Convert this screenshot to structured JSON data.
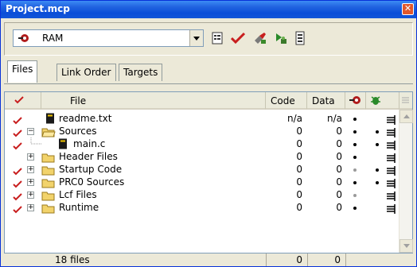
{
  "window": {
    "title": "Project.mcp"
  },
  "toolbar": {
    "target": "RAM",
    "buttons": [
      "settings-icon",
      "check-icon",
      "make-icon",
      "debug-icon",
      "list-icon"
    ]
  },
  "tabs": [
    {
      "label": "Files",
      "active": true
    },
    {
      "label": "Link Order",
      "active": false
    },
    {
      "label": "Targets",
      "active": false
    }
  ],
  "columns": {
    "file": "File",
    "code": "Code",
    "data": "Data"
  },
  "rows": [
    {
      "name": "readme.txt",
      "type": "file",
      "checked": true,
      "expander": "",
      "code": "n/a",
      "data": "n/a",
      "dbg": "black",
      "trg": ""
    },
    {
      "name": "Sources",
      "type": "folder",
      "checked": true,
      "expander": "−",
      "code": "0",
      "data": "0",
      "dbg": "black",
      "trg": "black"
    },
    {
      "name": "main.c",
      "type": "file",
      "checked": true,
      "expander": "",
      "code": "0",
      "data": "0",
      "dbg": "black",
      "trg": "black"
    },
    {
      "name": "Header Files",
      "type": "folder",
      "checked": false,
      "expander": "+",
      "code": "0",
      "data": "0",
      "dbg": "black",
      "trg": ""
    },
    {
      "name": "Startup Code",
      "type": "folder",
      "checked": true,
      "expander": "+",
      "code": "0",
      "data": "0",
      "dbg": "gray",
      "trg": "black"
    },
    {
      "name": "PRC0 Sources",
      "type": "folder",
      "checked": true,
      "expander": "+",
      "code": "0",
      "data": "0",
      "dbg": "black",
      "trg": "black"
    },
    {
      "name": "Lcf Files",
      "type": "folder",
      "checked": true,
      "expander": "+",
      "code": "0",
      "data": "0",
      "dbg": "gray",
      "trg": ""
    },
    {
      "name": "Runtime",
      "type": "folder",
      "checked": true,
      "expander": "+",
      "code": "0",
      "data": "0",
      "dbg": "black",
      "trg": ""
    }
  ],
  "status": {
    "files": "18 files",
    "code_total": "0",
    "data_total": "0"
  },
  "colors": {
    "title_bar": "#0a4ed8",
    "check": "#c81e1e",
    "folder": "#f2d36b"
  }
}
